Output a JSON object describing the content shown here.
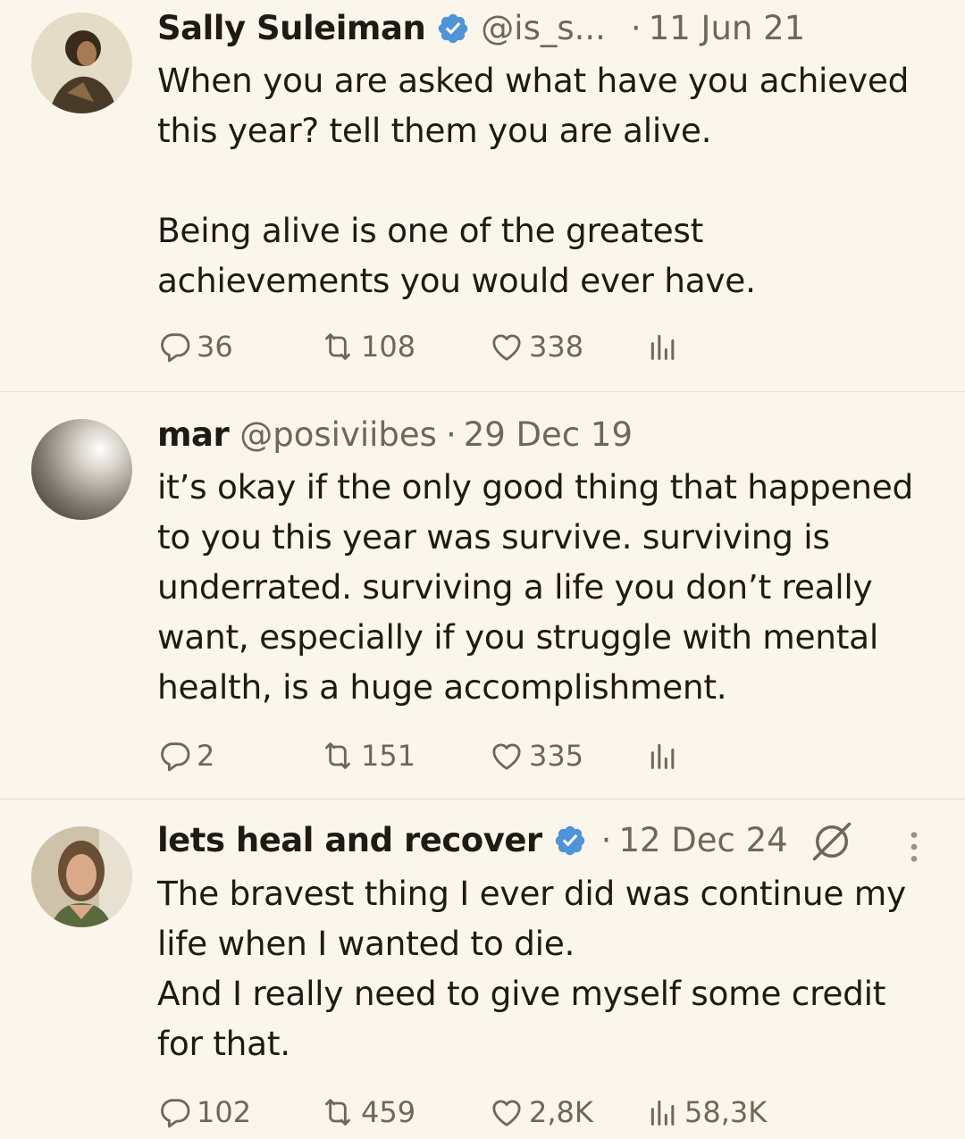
{
  "colors": {
    "background": "#fbf6ec",
    "text": "#1f1b14",
    "muted": "#6f6757",
    "verified": "#4f93d8",
    "divider": "#e4ddcf"
  },
  "tweets": [
    {
      "name": "Sally Suleiman",
      "verified": true,
      "handle": "@is_s...",
      "separator": "·",
      "date": "11 Jun 21",
      "paragraphs": [
        "When you are asked what have you achieved\nthis year? tell them you are alive.",
        "Being alive is one of the greatest\nachievements you would ever have."
      ],
      "replies": "36",
      "reposts": "108",
      "likes": "338",
      "views": ""
    },
    {
      "name": "mar",
      "verified": false,
      "handle": "@posiviibes",
      "separator": "·",
      "date": "29 Dec 19",
      "paragraphs": [
        "it’s okay if the only good thing that happened\nto you this year was survive. surviving is\nunderrated. surviving a life you don’t really\nwant, especially if you struggle with mental\nhealth, is a huge accomplishment."
      ],
      "replies": "2",
      "reposts": "151",
      "likes": "335",
      "views": ""
    },
    {
      "name": "lets heal and recover",
      "verified": true,
      "handle": "",
      "separator": "·",
      "date": "12 Dec 24",
      "paragraphs": [
        "The bravest thing I ever did was continue my\nlife when I wanted to die.\nAnd I really need to give myself some credit\nfor that."
      ],
      "replies": "102",
      "reposts": "459",
      "likes": "2,8K",
      "views": "58,3K"
    }
  ],
  "icons": {
    "verified": "verified-badge-icon",
    "reply": "reply-icon",
    "repost": "repost-icon",
    "like": "heart-icon",
    "views": "views-icon",
    "grok": "grok-icon",
    "more": "more-vertical-icon"
  }
}
